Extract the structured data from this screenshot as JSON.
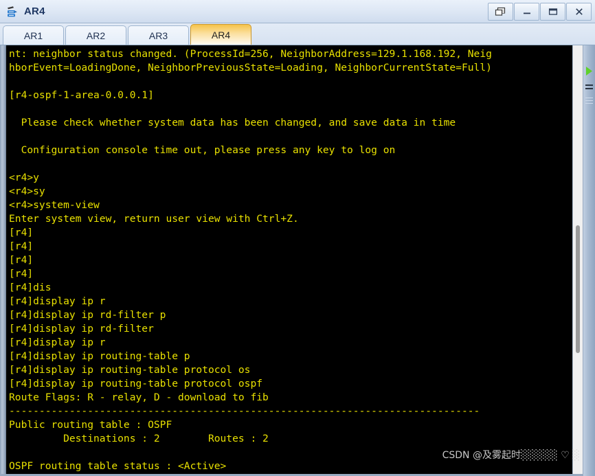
{
  "window": {
    "title": "AR4",
    "icon": "router-icon",
    "buttons": [
      {
        "name": "restore-button",
        "glyph": "❐",
        "label": "Restore"
      },
      {
        "name": "minimize-button",
        "glyph": "—",
        "label": "Minimize"
      },
      {
        "name": "maximize-button",
        "glyph": "❒",
        "label": "Maximize"
      },
      {
        "name": "close-button",
        "glyph": "✕",
        "label": "Close"
      }
    ]
  },
  "tabs": [
    {
      "label": "AR1",
      "active": false
    },
    {
      "label": "AR2",
      "active": false
    },
    {
      "label": "AR3",
      "active": false
    },
    {
      "label": "AR4",
      "active": true
    }
  ],
  "terminal": {
    "foreground_color": "#e8e000",
    "background_color": "#000000",
    "lines": [
      "nt: neighbor status changed. (ProcessId=256, NeighborAddress=129.1.168.192, Neig",
      "hborEvent=LoadingDone, NeighborPreviousState=Loading, NeighborCurrentState=Full)",
      "",
      "[r4-ospf-1-area-0.0.0.1]",
      "",
      "  Please check whether system data has been changed, and save data in time",
      "",
      "  Configuration console time out, please press any key to log on",
      "",
      "<r4>y",
      "<r4>sy",
      "<r4>system-view",
      "Enter system view, return user view with Ctrl+Z.",
      "[r4]",
      "[r4]",
      "[r4]",
      "[r4]",
      "[r4]dis",
      "[r4]display ip r",
      "[r4]display ip rd-filter p",
      "[r4]display ip rd-filter",
      "[r4]display ip r",
      "[r4]display ip routing-table p",
      "[r4]display ip routing-table protocol os",
      "[r4]display ip routing-table protocol ospf",
      "Route Flags: R - relay, D - download to fib",
      "------------------------------------------------------------------------------",
      "Public routing table : OSPF",
      "         Destinations : 2        Routes : 2",
      "",
      "OSPF routing table status : <Active>"
    ]
  },
  "scrollbar": {
    "name": "vertical-scrollbar",
    "thumb_name": "scrollbar-thumb"
  },
  "side_strip": {
    "green_marker": "green-arrow-marker",
    "menu_marks": "strip-menu-marks"
  },
  "watermark": {
    "text": "CSDN @及雾起时░░░░░ ♡ ░"
  }
}
